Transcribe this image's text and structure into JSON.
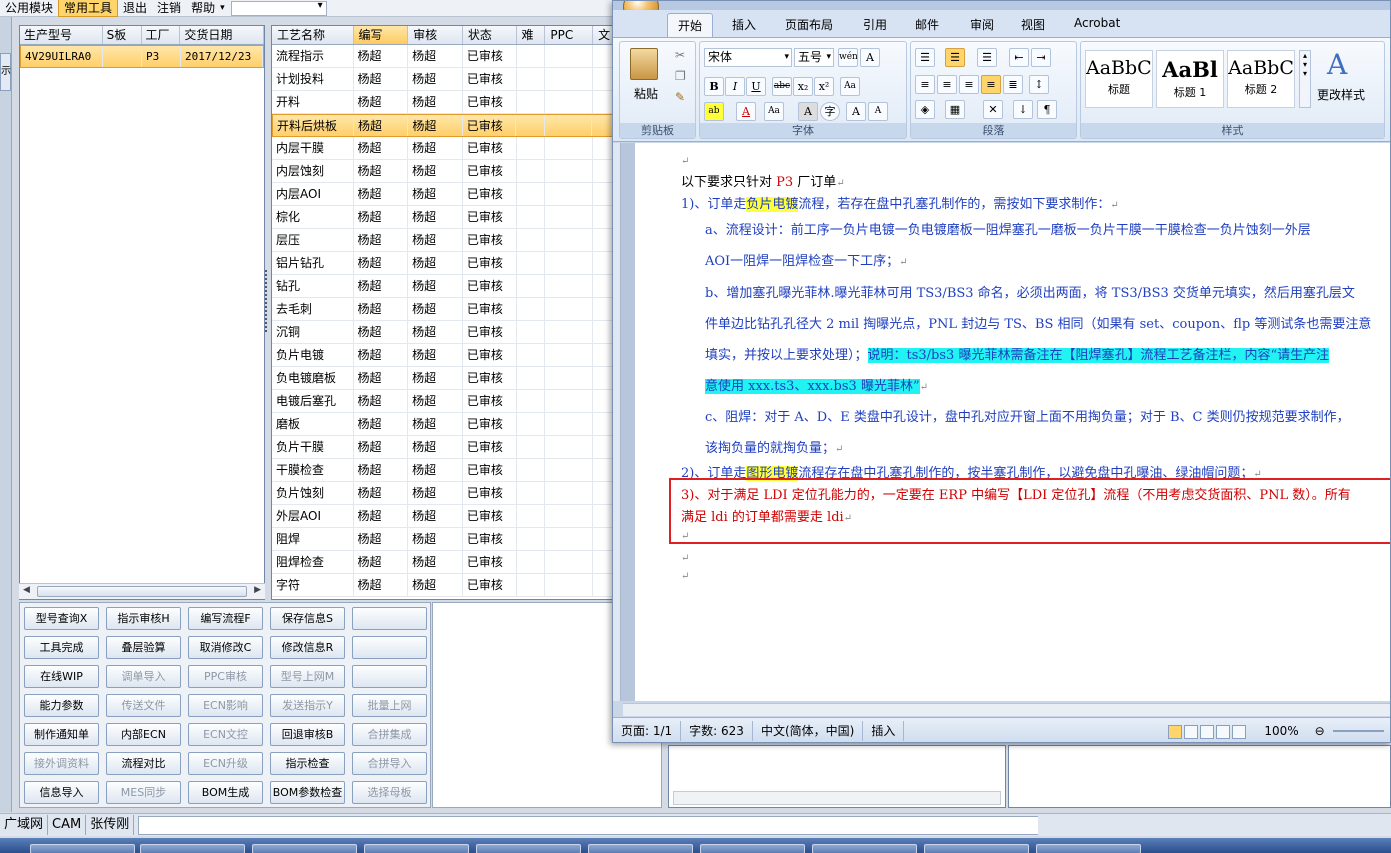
{
  "erp": {
    "menu": [
      "公用模块",
      "常用工具",
      "退出",
      "注销",
      "帮助"
    ],
    "left_tab": "示",
    "grid1": {
      "headers": [
        "生产型号",
        "S板",
        "工厂",
        "交货日期"
      ],
      "row": [
        "4V29UILRA0",
        "",
        "P3",
        "2017/12/23"
      ]
    },
    "grid2": {
      "headers": [
        "工艺名称",
        "编写",
        "审核",
        "状态",
        "难",
        "PPC",
        "文"
      ],
      "rows": [
        [
          "流程指示",
          "杨超",
          "杨超",
          "已审核"
        ],
        [
          "计划投料",
          "杨超",
          "杨超",
          "已审核"
        ],
        [
          "开料",
          "杨超",
          "杨超",
          "已审核"
        ],
        [
          "开料后烘板",
          "杨超",
          "杨超",
          "已审核"
        ],
        [
          "内层干膜",
          "杨超",
          "杨超",
          "已审核"
        ],
        [
          "内层蚀刻",
          "杨超",
          "杨超",
          "已审核"
        ],
        [
          "内层AOI",
          "杨超",
          "杨超",
          "已审核"
        ],
        [
          "棕化",
          "杨超",
          "杨超",
          "已审核"
        ],
        [
          "层压",
          "杨超",
          "杨超",
          "已审核"
        ],
        [
          "铝片钻孔",
          "杨超",
          "杨超",
          "已审核"
        ],
        [
          "钻孔",
          "杨超",
          "杨超",
          "已审核"
        ],
        [
          "去毛刺",
          "杨超",
          "杨超",
          "已审核"
        ],
        [
          "沉铜",
          "杨超",
          "杨超",
          "已审核"
        ],
        [
          "负片电镀",
          "杨超",
          "杨超",
          "已审核"
        ],
        [
          "负电镀磨板",
          "杨超",
          "杨超",
          "已审核"
        ],
        [
          "电镀后塞孔",
          "杨超",
          "杨超",
          "已审核"
        ],
        [
          "磨板",
          "杨超",
          "杨超",
          "已审核"
        ],
        [
          "负片干膜",
          "杨超",
          "杨超",
          "已审核"
        ],
        [
          "干膜检查",
          "杨超",
          "杨超",
          "已审核"
        ],
        [
          "负片蚀刻",
          "杨超",
          "杨超",
          "已审核"
        ],
        [
          "外层AOI",
          "杨超",
          "杨超",
          "已审核"
        ],
        [
          "阻焊",
          "杨超",
          "杨超",
          "已审核"
        ],
        [
          "阻焊检查",
          "杨超",
          "杨超",
          "已审核"
        ],
        [
          "字符",
          "杨超",
          "杨超",
          "已审核"
        ]
      ]
    },
    "buttons": [
      [
        "型号查询X",
        "指示审核H",
        "编写流程F",
        "保存信息S",
        ""
      ],
      [
        "工具完成",
        "叠层验算",
        "取消修改C",
        "修改信息R",
        ""
      ],
      [
        "在线WIP",
        "调单导入",
        "PPC审核",
        "型号上网M",
        ""
      ],
      [
        "能力参数",
        "传送文件",
        "ECN影响",
        "发送指示Y",
        "批量上网"
      ],
      [
        "制作通知单",
        "内部ECN",
        "ECN文控",
        "回退审核B",
        "合拼集成"
      ],
      [
        "接外调资料",
        "流程对比",
        "ECN升级",
        "指示检查",
        "合拼导入"
      ],
      [
        "信息导入",
        "MES同步",
        "BOM生成",
        "BOM参数检查",
        "选择母板"
      ]
    ],
    "status": [
      "广域网",
      "CAM",
      "张传刚"
    ]
  },
  "word": {
    "tabs": [
      "开始",
      "插入",
      "页面布局",
      "引用",
      "邮件",
      "审阅",
      "视图",
      "Acrobat"
    ],
    "clipboard": {
      "paste": "粘贴",
      "label": "剪贴板"
    },
    "font": {
      "name": "宋体",
      "size": "五号",
      "label": "字体"
    },
    "paragraph_label": "段落",
    "styles": [
      {
        "sample": "AaBbC(",
        "name": "标题"
      },
      {
        "sample": "AaBl",
        "name": "标题 1"
      },
      {
        "sample": "AaBbC",
        "name": "标题 2"
      }
    ],
    "change_styles": "更改样式",
    "styles_label": "样式",
    "doc": {
      "l1_a": "以下要求只针对 ",
      "l1_b": "P3",
      "l1_c": " 厂订单",
      "l2_a": "1)、订单走",
      "l2_b": "负片电镀",
      "l2_c": "流程，若存在盘中孔塞孔制作的，需按如下要求制作：",
      "l3": "a、流程设计：前工序一负片电镀一负电镀磨板一阻焊塞孔一磨板一负片干膜一干膜检查一负片蚀刻一外层",
      "l4": "AOI一阻焊一阻焊检查一下工序；",
      "l5": "b、增加塞孔曝光菲林.曝光菲林可用 TS3/BS3 命名，必须出两面，将 TS3/BS3 交货单元填实，然后用塞孔层文",
      "l6": "件单边比钻孔孔径大 2 mil 掏曝光点，PNL 封边与 TS、BS 相同（如果有 set、coupon、flp 等测试条也需要注意",
      "l7_a": "填实，并按以上要求处理）；",
      "l7_b": "说明：ts3/bs3 曝光菲林需备注在【阻焊塞孔】流程工艺备注栏，内容“请生产注",
      "l8": "意使用 xxx.ts3、xxx.bs3 曝光菲林”",
      "l9": "c、阻焊：对于 A、D、E 类盘中孔设计，盘中孔对应开窗上面不用掏负量；对于 B、C 类则仍按规范要求制作，",
      "l10": "该掏负量的就掏负量；",
      "l11_a": "2)、订单走",
      "l11_b": "图形电镀",
      "l11_c": "流程存在盘中孔塞孔制作的，按半塞孔制作，以避免盘中孔曝油、绿油帽问题；",
      "l12": "3)、对于满足 LDI 定位孔能力的，一定要在 ERP 中编写【LDI 定位孔】流程（不用考虑交货面积、PNL 数）。所有",
      "l13": "满足 ldi 的订单都需要走 ldi"
    },
    "status": {
      "page": "页面: 1/1",
      "words": "字数: 623",
      "lang": "中文(简体，中国)",
      "mode": "插入",
      "zoom": "100%"
    }
  }
}
